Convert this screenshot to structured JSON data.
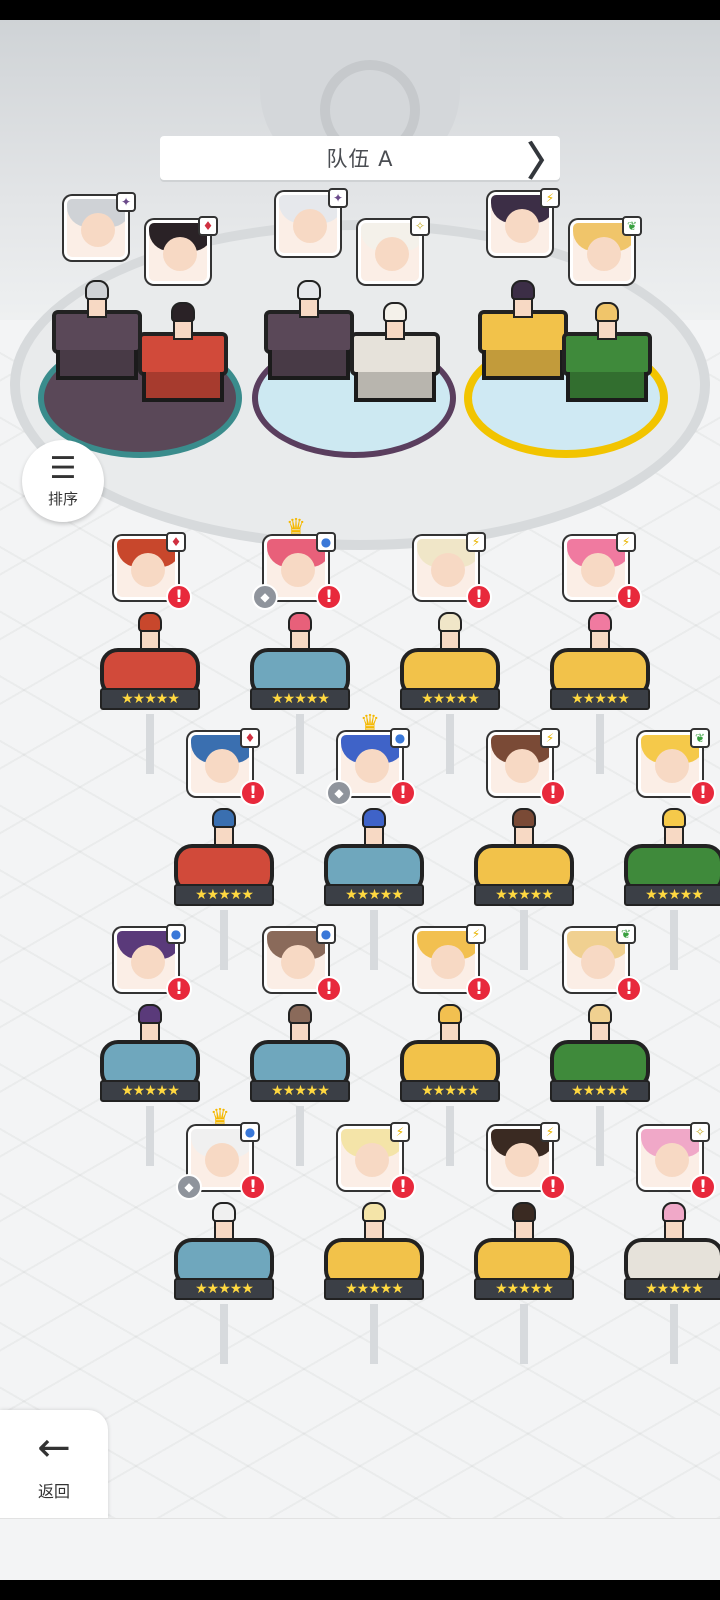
{
  "team": {
    "title": "队伍 A",
    "prev": "〈",
    "next": "〉"
  },
  "sort": {
    "label": "排序",
    "icon": "sort-icon"
  },
  "back": {
    "label": "返回",
    "icon": "arrow-left-icon"
  },
  "colors": {
    "red": "#d14a3a",
    "blue": "#6fa7bd",
    "yellow": "#f2c24a",
    "green": "#3f8a3b",
    "purple": "#5a4858",
    "white": "#e6e2da",
    "alert": "#e8293c",
    "crown": "#f5b800"
  },
  "element_icons": {
    "dark": "✦",
    "fire": "♦",
    "light": "✧",
    "lightning": "⚡",
    "nature": "❦",
    "water": "●"
  },
  "party": [
    {
      "element": "dark",
      "hair": "#cfd2d6",
      "pedestal": "purple"
    },
    {
      "element": "fire",
      "hair": "#2a2226",
      "pedestal": "red"
    },
    {
      "element": "dark",
      "hair": "#e6e8ec",
      "pedestal": "purple"
    },
    {
      "element": "light",
      "hair": "#f4f1ea",
      "pedestal": "white"
    },
    {
      "element": "lightning",
      "hair": "#3c2e46",
      "pedestal": "yellow"
    },
    {
      "element": "nature",
      "hair": "#f0c56a",
      "pedestal": "green"
    }
  ],
  "roster": [
    {
      "element": "fire",
      "hair": "#c8472c",
      "color": "red",
      "crown": false,
      "gem": false,
      "stars": "★★★★★"
    },
    {
      "element": "water",
      "hair": "#e8607a",
      "color": "blue",
      "crown": true,
      "gem": true,
      "stars": "★★★★★"
    },
    {
      "element": "lightning",
      "hair": "#f0e6c8",
      "color": "yellow",
      "crown": false,
      "gem": false,
      "stars": "★★★★★"
    },
    {
      "element": "lightning",
      "hair": "#f07aa0",
      "color": "yellow",
      "crown": false,
      "gem": false,
      "stars": "★★★★★"
    },
    {
      "element": "fire",
      "hair": "#3a6fb0",
      "color": "red",
      "crown": false,
      "gem": false,
      "stars": "★★★★★"
    },
    {
      "element": "water",
      "hair": "#3f63c8",
      "color": "blue",
      "crown": true,
      "gem": true,
      "stars": "★★★★★"
    },
    {
      "element": "lightning",
      "hair": "#7a4a36",
      "color": "yellow",
      "crown": false,
      "gem": false,
      "stars": "★★★★★"
    },
    {
      "element": "nature",
      "hair": "#f5c94a",
      "color": "green",
      "crown": false,
      "gem": false,
      "stars": "★★★★★"
    },
    {
      "element": "water",
      "hair": "#5a3a7a",
      "color": "blue",
      "crown": false,
      "gem": false,
      "stars": "★★★★★"
    },
    {
      "element": "water",
      "hair": "#8a6a5a",
      "color": "blue",
      "crown": false,
      "gem": false,
      "stars": "★★★★★"
    },
    {
      "element": "lightning",
      "hair": "#f2c050",
      "color": "yellow",
      "crown": false,
      "gem": false,
      "stars": "★★★★★"
    },
    {
      "element": "nature",
      "hair": "#f0d090",
      "color": "green",
      "crown": false,
      "gem": false,
      "stars": "★★★★★"
    },
    {
      "element": "water",
      "hair": "#f0f0f0",
      "color": "blue",
      "crown": true,
      "gem": true,
      "stars": "★★★★★"
    },
    {
      "element": "lightning",
      "hair": "#f4e4a8",
      "color": "yellow",
      "crown": false,
      "gem": false,
      "stars": "★★★★★"
    },
    {
      "element": "lightning",
      "hair": "#3a2a22",
      "color": "yellow",
      "crown": false,
      "gem": false,
      "stars": "★★★★★"
    },
    {
      "element": "light",
      "hair": "#f0a8c8",
      "color": "white",
      "crown": false,
      "gem": false,
      "stars": "★★★★★"
    }
  ]
}
